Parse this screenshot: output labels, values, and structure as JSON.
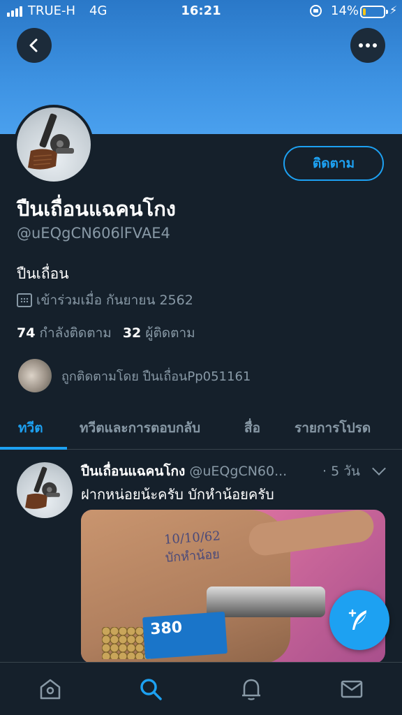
{
  "status_bar": {
    "carrier": "TRUE-H",
    "network": "4G",
    "time": "16:21",
    "battery_percent": "14%",
    "battery_level": 0.14
  },
  "profile": {
    "display_name": "ปืนเถื่อนแฉคนโกง",
    "handle": "@uEQgCN606lFVAE4",
    "follow_label": "ติดตาม",
    "bio": "ปืนเถื่อน",
    "joined": "เข้าร่วมเมื่อ กันยายน 2562",
    "following_count": "74",
    "following_label": "กำลังติดตาม",
    "followers_count": "32",
    "followers_label": "ผู้ติดตาม",
    "followed_by": "ถูกติดตามโดย ปืนเถื่อนPp051161"
  },
  "tabs": [
    {
      "label": "ทวีต",
      "active": true
    },
    {
      "label": "ทวีตและการตอบกลับ",
      "active": false
    },
    {
      "label": "สื่อ",
      "active": false
    },
    {
      "label": "รายการโปรด",
      "active": false
    }
  ],
  "tweet": {
    "name": "ปืนเถื่อนแฉคนโกง",
    "handle": "@uEQgCN60...",
    "time": "· 5 วัน",
    "text": "ฝากหน่อยน้ะครับ บักหำน้อยครับ",
    "media": {
      "handwriting_line1": "10/10/62",
      "handwriting_line2": "บักหำน้อย",
      "ammo_label": "380"
    }
  },
  "colors": {
    "accent": "#1da1f2",
    "background": "#15202b",
    "muted_text": "#8899a6",
    "banner": "#3d92e2"
  },
  "icons": {
    "back": "back-arrow-icon",
    "more": "more-dots-icon",
    "calendar": "calendar-icon",
    "compose": "compose-tweet-icon",
    "home": "home-icon",
    "search": "search-icon",
    "notifications": "bell-icon",
    "messages": "envelope-icon"
  }
}
